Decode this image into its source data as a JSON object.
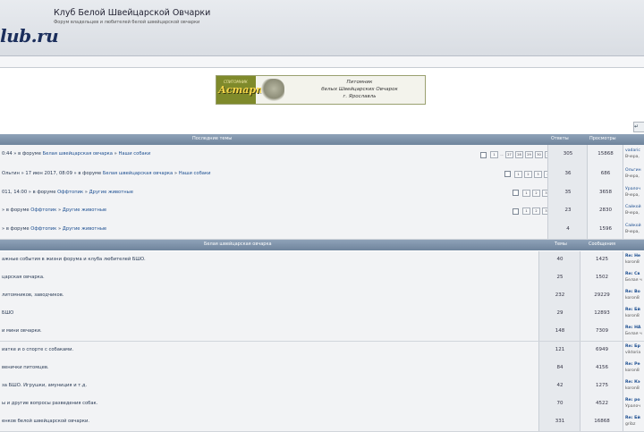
{
  "header": {
    "logo": "lub.ru",
    "title": "Клуб Белой Швейцарской Овчарки",
    "description": "Форум владельцев и любителей белой швейцарской овчарки"
  },
  "banner": {
    "subtitle": "СПИТОМНИК",
    "name": "Астарта",
    "line1": "Питомник",
    "line2": "белых Швейцарских Овчарок",
    "line3": "г. Ярославль"
  },
  "side_button": "↵",
  "topics": {
    "heading": "Последние темы",
    "col_replies": "Ответы",
    "col_views": "Просмотры",
    "rows": [
      {
        "prefix": "0:44 » в форуме ",
        "forum": "Белая швейцарская овчарка",
        "sep": " » ",
        "sub": "Наши собаки",
        "replies": "305",
        "views": "15868",
        "last1": "vadaric",
        "last2": "Вчера,",
        "pages": [
          "1",
          "...",
          "27",
          "28",
          "29",
          "30",
          "31"
        ]
      },
      {
        "prefix": "Ольгин » 17 июн 2017, 08:09 » в форуме ",
        "forum": "Белая швейцарская овчарка",
        "sep": " » ",
        "sub": "Наши собаки",
        "replies": "36",
        "views": "686",
        "last1": "Ольгин",
        "last2": "Вчера,",
        "pages": [
          "1",
          "2",
          "3",
          "4"
        ]
      },
      {
        "prefix": "011, 14:00 » в форуме ",
        "forum": "Оффтопик",
        "sep": " » ",
        "sub": "Другие животные",
        "replies": "35",
        "views": "3658",
        "last1": "Уралоч",
        "last2": "Вчера,",
        "pages": [
          "1",
          "2",
          "3"
        ]
      },
      {
        "prefix": "» в форуме ",
        "forum": "Оффтопик",
        "sep": " » ",
        "sub": "Другие животные",
        "replies": "23",
        "views": "2830",
        "last1": "Сайкой",
        "last2": "Вчера,",
        "pages": [
          "1",
          "2",
          "3"
        ]
      },
      {
        "prefix": "» в форуме ",
        "forum": "Оффтопик",
        "sep": " » ",
        "sub": "Другие животные",
        "replies": "4",
        "views": "1596",
        "last1": "Сайкой",
        "last2": "Вчера,",
        "pages": []
      }
    ]
  },
  "forums": {
    "heading": "Белая швейцарская овчарка",
    "col_topics": "Темы",
    "col_posts": "Сообщения",
    "rows": [
      {
        "desc": "ажные события в жизни форума и клуба любителей БШО.",
        "topics": "40",
        "posts": "1425",
        "last1": "Re: Не",
        "last2": "koron8"
      },
      {
        "desc": "царская овчарка.",
        "topics": "25",
        "posts": "1502",
        "last1": "Re: Св",
        "last2": "Белая ч"
      },
      {
        "desc": "литомников, заводчиков.",
        "topics": "232",
        "posts": "29229",
        "last1": "Re: Во",
        "last2": "koron8"
      },
      {
        "desc": "БШО",
        "topics": "29",
        "posts": "12893",
        "last1": "Re: Бй",
        "last2": "koron8"
      },
      {
        "desc": "и мини овчарки.",
        "topics": "148",
        "posts": "7309",
        "last1": "Re: НА",
        "last2": "Белая ч"
      },
      {
        "desc": "иатке и о спорте с собаками.",
        "topics": "121",
        "posts": "6949",
        "last1": "Re: Бр",
        "last2": "viktoria"
      },
      {
        "desc": "венички питомцев.",
        "topics": "84",
        "posts": "4156",
        "last1": "Re: Ре",
        "last2": "koron8"
      },
      {
        "desc": "за БШО. Игрушки, амуниция и т.д.",
        "topics": "42",
        "posts": "1275",
        "last1": "Re: Кэ",
        "last2": "koron8"
      },
      {
        "desc": "ы и другие вопросы разведения собак.",
        "topics": "70",
        "posts": "4522",
        "last1": "Re: ро",
        "last2": "Уралоч"
      },
      {
        "desc": "енков белой швейцарской овчарки.",
        "topics": "331",
        "posts": "16868",
        "last1": "Re: Бй",
        "last2": "gribz"
      }
    ]
  }
}
